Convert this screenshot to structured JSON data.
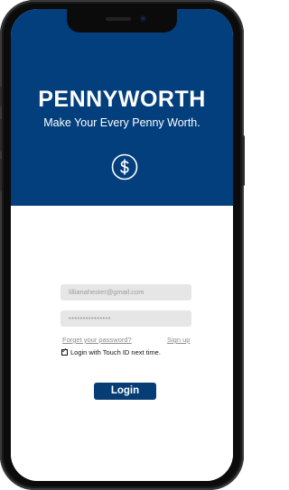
{
  "app": {
    "title": "PENNYWORTH",
    "tagline": "Make Your Every Penny Worth.",
    "logo_icon": "dollar-circle-icon"
  },
  "login_form": {
    "email_placeholder": "lillianahester@gmail.com",
    "password_placeholder": "•••••••••••••••",
    "forgot_password_label": "Forget your password?",
    "signup_label": "Sign up",
    "touch_id_label": "Login with Touch ID next time.",
    "touch_id_checked": true,
    "login_button_label": "Login"
  },
  "colors": {
    "brand_blue": "#033f7d",
    "button_blue": "#073d75",
    "field_bg": "#e6e6e6",
    "link_gray": "#8c8c8c"
  }
}
